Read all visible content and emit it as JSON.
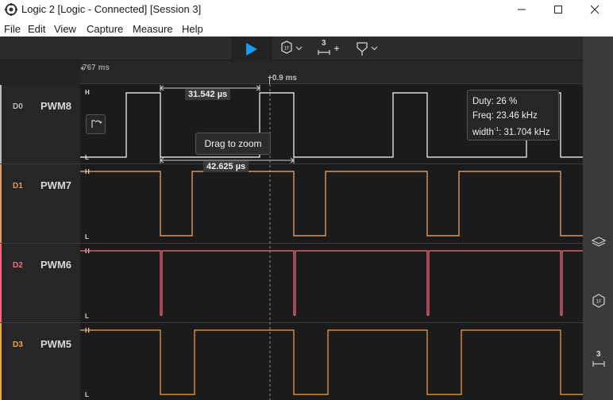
{
  "window": {
    "title": "Logic 2 [Logic - Connected] [Session 3]",
    "app_icon": "logic-app-icon",
    "controls": [
      "minimize-icon",
      "maximize-icon",
      "close-icon"
    ]
  },
  "menu": [
    "File",
    "Edit",
    "View",
    "Capture",
    "Measure",
    "Help"
  ],
  "toolbar": {
    "play_icon": "play-icon",
    "trigger_icon": "trigger-icon",
    "measure_label": "3",
    "marker_icon": "marker-icon",
    "accent": "#1a9cf2"
  },
  "ruler": {
    "start_time": "767 ms",
    "offset": "+0.9 ms"
  },
  "channels": [
    {
      "id": "D0",
      "name": "PWM8",
      "color": "#ffffff",
      "id_color": "#bbbbbb",
      "high": "H",
      "low": "L"
    },
    {
      "id": "D1",
      "name": "PWM7",
      "color": "#f5b07a",
      "id_color": "#e09a66",
      "high": "H",
      "low": "L"
    },
    {
      "id": "D2",
      "name": "PWM6",
      "color": "#ff6b78",
      "id_color": "#ff6b78",
      "high": "H",
      "low": "L"
    },
    {
      "id": "D3",
      "name": "PWM5",
      "color": "#f2a24a",
      "id_color": "#f2a24a",
      "high": "H",
      "low": "L"
    }
  ],
  "measurements": {
    "width_top": "31.542 µs",
    "width_bottom": "42.625 µs",
    "tooltip": "Drag to zoom"
  },
  "stats": {
    "duty": "Duty: 26 %",
    "freq": "Freq: 23.46 kHz",
    "width_prefix": "width",
    "width_sup": "-1",
    "width_value": ": 31.704 kHz"
  },
  "sidebar": {
    "icons": [
      "layers-icon",
      "analyzer-icon",
      "measurement-icon"
    ],
    "measurement_label": "3"
  }
}
